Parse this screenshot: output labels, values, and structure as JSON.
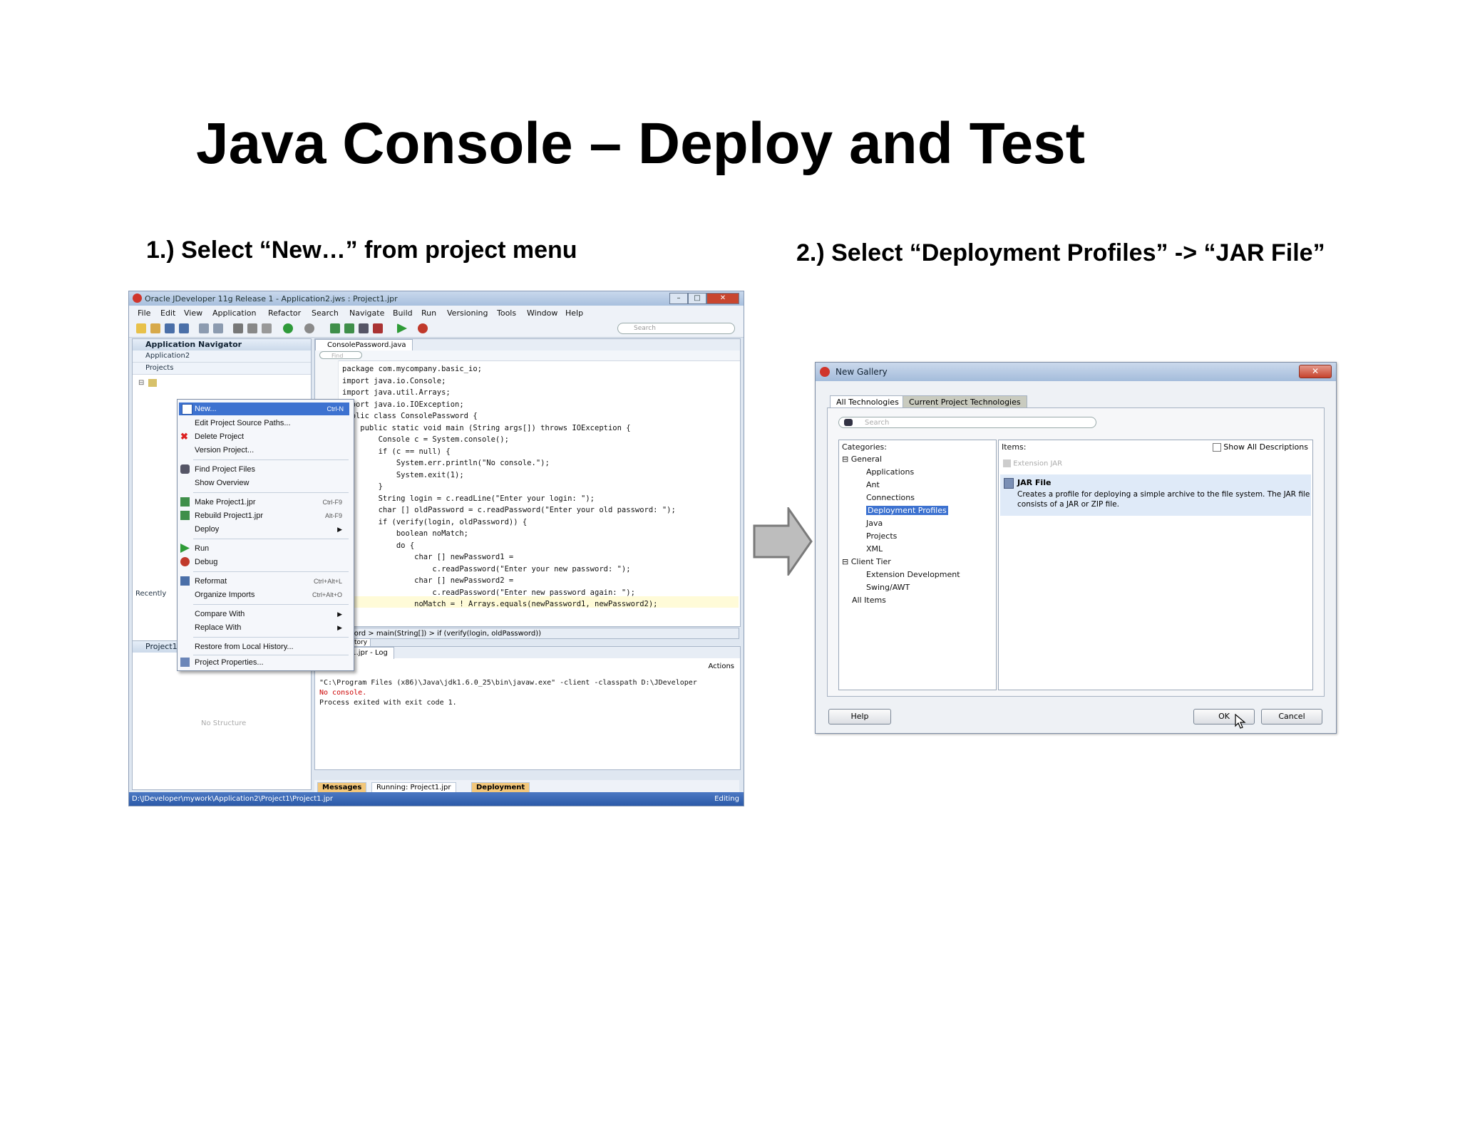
{
  "slide": {
    "title": "Java Console – Deploy and Test",
    "step1": "1.) Select “New…” from project menu",
    "step2": "2.) Select “Deployment Profiles” -> “JAR File”"
  },
  "ide": {
    "window_title": "Oracle JDeveloper 11g Release 1 - Application2.jws : Project1.jpr",
    "menus": [
      "File",
      "Edit",
      "View",
      "Application",
      "Refactor",
      "Search",
      "Navigate",
      "Build",
      "Run",
      "Versioning",
      "Tools",
      "Window",
      "Help"
    ],
    "search_placeholder": "Search",
    "nav_title": "Application Navigator",
    "nav_app": "Application2",
    "nav_projects": "Projects",
    "recently": "Recently",
    "structure_tab": "Project1",
    "no_structure": "No Structure",
    "editor_tab": "ConsolePassword.java",
    "find_placeholder": "Find",
    "code_lines": [
      "package com.mycompany.basic_io;",
      "import java.io.Console;",
      "import java.util.Arrays;",
      "import java.io.IOException;",
      "public class ConsolePassword {",
      "    public static void main (String args[]) throws IOException {",
      "        Console c = System.console();",
      "        if (c == null) {",
      "            System.err.println(\"No console.\");",
      "            System.exit(1);",
      "        }",
      "        String login = c.readLine(\"Enter your login: \");",
      "        char [] oldPassword = c.readPassword(\"Enter your old password: \");",
      "        if (verify(login, oldPassword)) {",
      "            boolean noMatch;",
      "            do {",
      "                char [] newPassword1 =",
      "                    c.readPassword(\"Enter your new password: \");",
      "                char [] newPassword2 =",
      "                    c.readPassword(\"Enter new password again: \");",
      "                noMatch = ! Arrays.equals(newPassword1, newPassword2);"
    ],
    "breadcrumb": "assword > main(String[]) > if (verify(login, oldPassword))",
    "editor_bottom_tabs": [
      "esign",
      "History"
    ],
    "log_tab": "Project1.jpr - Log",
    "actions_label": "Actions",
    "log_lines": [
      "\"C:\\Program Files (x86)\\Java\\jdk1.6.0_25\\bin\\javaw.exe\" -client -classpath D:\\JDeveloper",
      "No console.",
      "Process exited with exit code 1."
    ],
    "bottom_tabs": [
      "Messages",
      "Running: Project1.jpr",
      "Deployment"
    ],
    "status_path": "D:\\JDeveloper\\mywork\\Application2\\Project1\\Project1.jpr",
    "status_mode": "Editing",
    "context_menu": {
      "new": "New...",
      "new_shortcut": "Ctrl-N",
      "edit_paths": "Edit Project Source Paths...",
      "delete": "Delete Project",
      "version": "Version Project...",
      "find_files": "Find Project Files",
      "show_overview": "Show Overview",
      "make": "Make Project1.jpr",
      "make_shortcut": "Ctrl-F9",
      "rebuild": "Rebuild Project1.jpr",
      "rebuild_shortcut": "Alt-F9",
      "deploy": "Deploy",
      "run": "Run",
      "debug": "Debug",
      "reformat": "Reformat",
      "reformat_shortcut": "Ctrl+Alt+L",
      "organize": "Organize Imports",
      "organize_shortcut": "Ctrl+Alt+O",
      "compare": "Compare With",
      "replace": "Replace With",
      "restore": "Restore from Local History...",
      "properties": "Project Properties..."
    }
  },
  "gallery": {
    "title": "New Gallery",
    "tab_all": "All Technologies",
    "tab_current": "Current Project Technologies",
    "search_placeholder": "Search",
    "categories_label": "Categories:",
    "items_label": "Items:",
    "show_all": "Show All Descriptions",
    "tree": [
      "General",
      "Applications",
      "Ant",
      "Connections",
      "Deployment Profiles",
      "Java",
      "Projects",
      "XML",
      "Client Tier",
      "Extension Development",
      "Swing/AWT",
      "All Items"
    ],
    "item_ext": "Extension JAR",
    "item_jar_title": "JAR File",
    "item_jar_desc1": "Creates a profile for deploying a simple archive to the file system. The JAR file",
    "item_jar_desc2": "consists of a JAR or ZIP file.",
    "help": "Help",
    "ok": "OK",
    "cancel": "Cancel"
  }
}
